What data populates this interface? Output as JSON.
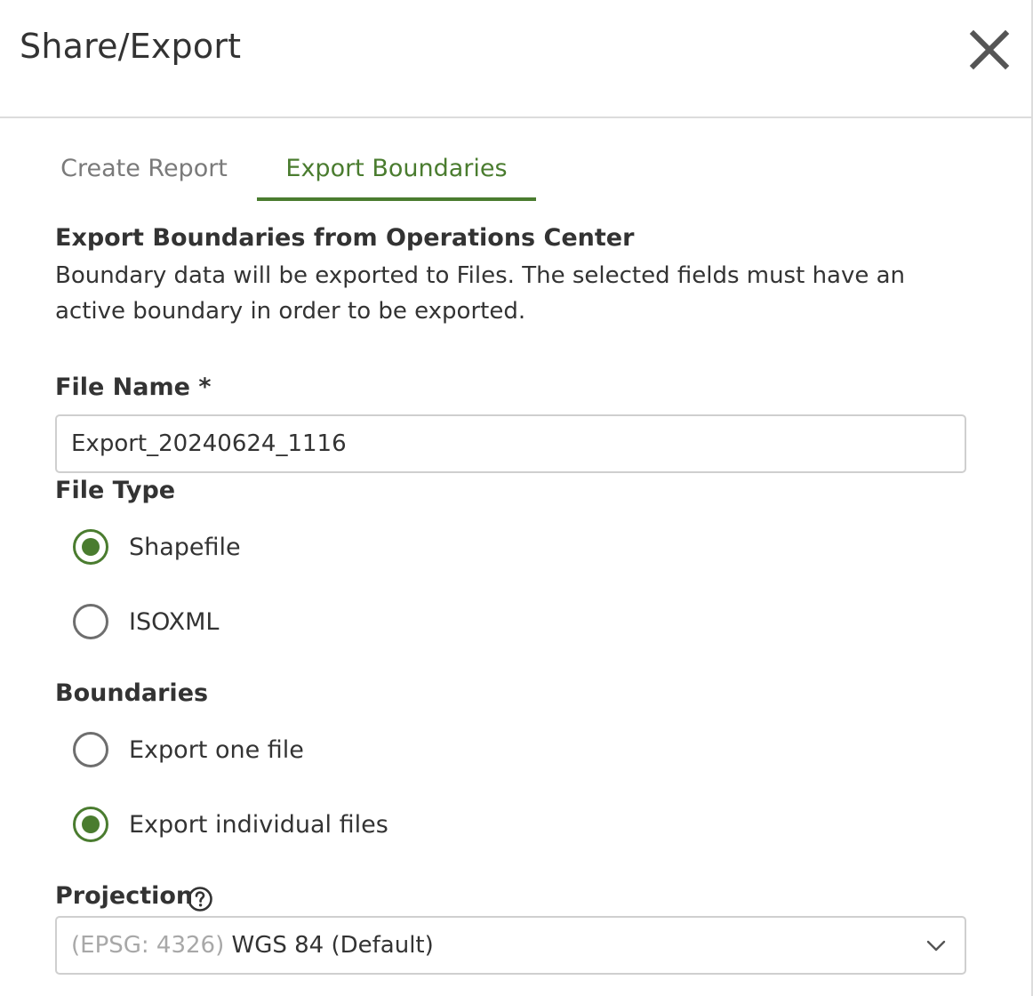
{
  "header": {
    "title": "Share/Export",
    "close_icon": "close-icon"
  },
  "tabs": [
    {
      "label": "Create Report",
      "active": false
    },
    {
      "label": "Export Boundaries",
      "active": true
    }
  ],
  "section": {
    "heading": "Export Boundaries from Operations Center",
    "description": "Boundary data will be exported to Files. The selected fields must have an active boundary in order to be exported."
  },
  "file_name": {
    "label": "File Name *",
    "value": "Export_20240624_1116"
  },
  "file_type": {
    "label": "File Type",
    "options": [
      {
        "label": "Shapefile",
        "checked": true
      },
      {
        "label": "ISOXML",
        "checked": false
      }
    ]
  },
  "boundaries": {
    "label": "Boundaries",
    "options": [
      {
        "label": "Export one file",
        "checked": false
      },
      {
        "label": "Export individual files",
        "checked": true
      }
    ]
  },
  "projection": {
    "label": "Projection",
    "help_icon": "help-circle-icon",
    "selected_code": "(EPSG: 4326)",
    "selected_name": "WGS 84 (Default)"
  },
  "colors": {
    "accent": "#4a7c2f",
    "text": "#333333",
    "muted": "#7a7a7a",
    "border": "#cfcfcf"
  }
}
